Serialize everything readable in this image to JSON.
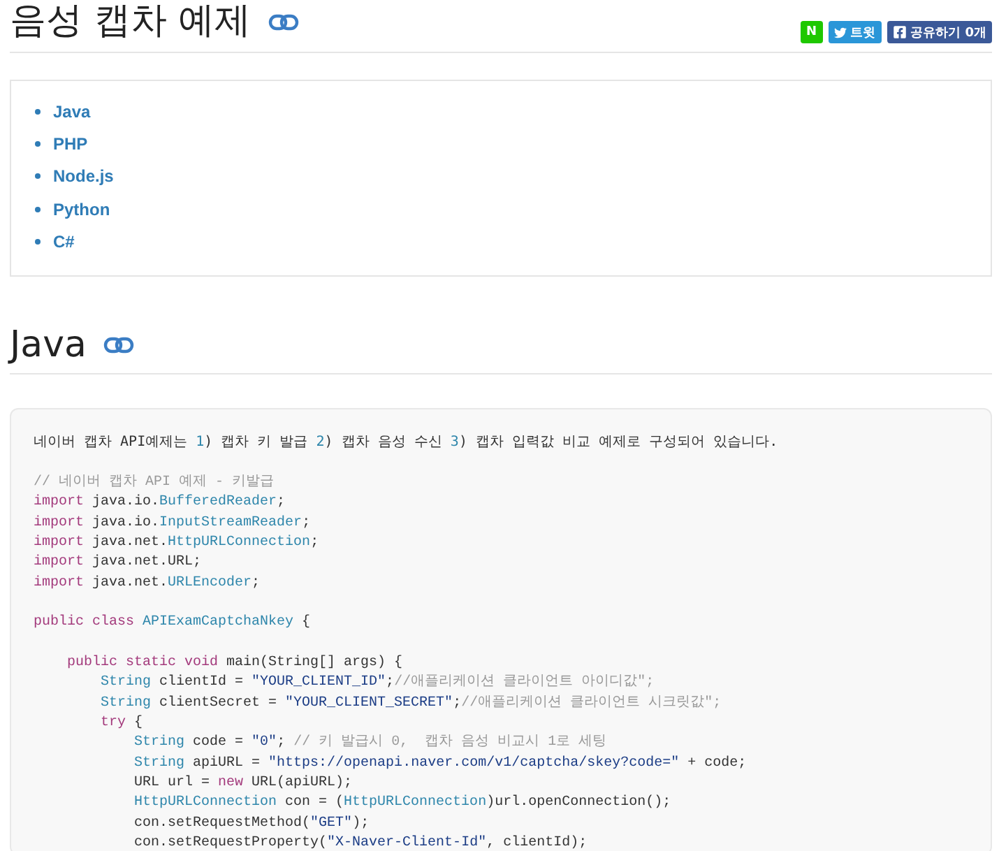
{
  "title": {
    "text": "음성 캡차 예제"
  },
  "share_buttons": [
    {
      "kind": "naver",
      "label": "N"
    },
    {
      "kind": "twitter",
      "label": "트윗"
    },
    {
      "kind": "facebook",
      "label": "공유하기 0개"
    }
  ],
  "toc": [
    "Java",
    "PHP",
    "Node.js",
    "Python",
    "C#"
  ],
  "section": {
    "title": "Java"
  },
  "intro": [
    {
      "kind": "plain",
      "text": "네이버 캡차 API예제는 "
    },
    {
      "kind": "number",
      "text": "1"
    },
    {
      "kind": "plain",
      "text": ") 캡차 키 발급 "
    },
    {
      "kind": "number",
      "text": "2"
    },
    {
      "kind": "plain",
      "text": ") 캡차 음성 수신 "
    },
    {
      "kind": "number",
      "text": "3"
    },
    {
      "kind": "plain",
      "text": ") 캡차 입력값 비교 예제로 구성되어 있습니다."
    }
  ],
  "code_blocks": [
    [
      [
        {
          "kind": "comment",
          "text": "// 네이버 캡차 API 예제 - 키발급"
        }
      ],
      [
        {
          "kind": "keyword",
          "text": "import"
        },
        {
          "kind": "plain",
          "text": " java.io."
        },
        {
          "kind": "type",
          "text": "BufferedReader"
        },
        {
          "kind": "plain",
          "text": ";"
        }
      ],
      [
        {
          "kind": "keyword",
          "text": "import"
        },
        {
          "kind": "plain",
          "text": " java.io."
        },
        {
          "kind": "type",
          "text": "InputStreamReader"
        },
        {
          "kind": "plain",
          "text": ";"
        }
      ],
      [
        {
          "kind": "keyword",
          "text": "import"
        },
        {
          "kind": "plain",
          "text": " java.net."
        },
        {
          "kind": "type",
          "text": "HttpURLConnection"
        },
        {
          "kind": "plain",
          "text": ";"
        }
      ],
      [
        {
          "kind": "keyword",
          "text": "import"
        },
        {
          "kind": "plain",
          "text": " java.net.URL;"
        }
      ],
      [
        {
          "kind": "keyword",
          "text": "import"
        },
        {
          "kind": "plain",
          "text": " java.net."
        },
        {
          "kind": "type",
          "text": "URLEncoder"
        },
        {
          "kind": "plain",
          "text": ";"
        }
      ]
    ],
    [
      [
        {
          "kind": "keyword",
          "text": "public class"
        },
        {
          "kind": "type",
          "text": " APIExamCaptchaNkey"
        },
        {
          "kind": "plain",
          "text": " {"
        }
      ]
    ],
    [
      [
        {
          "kind": "keyword",
          "text": "    public static void"
        },
        {
          "kind": "plain",
          "text": " main(String[] args) {"
        }
      ],
      [
        {
          "kind": "type",
          "text": "        String"
        },
        {
          "kind": "plain",
          "text": " clientId = "
        },
        {
          "kind": "string",
          "text": "\"YOUR_CLIENT_ID\""
        },
        {
          "kind": "plain",
          "text": ";"
        },
        {
          "kind": "comment",
          "text": "//애플리케이션 클라이언트 아이디값\";"
        }
      ],
      [
        {
          "kind": "type",
          "text": "        String"
        },
        {
          "kind": "plain",
          "text": " clientSecret = "
        },
        {
          "kind": "string",
          "text": "\"YOUR_CLIENT_SECRET\""
        },
        {
          "kind": "plain",
          "text": ";"
        },
        {
          "kind": "comment",
          "text": "//애플리케이션 클라이언트 시크릿값\";"
        }
      ],
      [
        {
          "kind": "keyword",
          "text": "        try"
        },
        {
          "kind": "plain",
          "text": " {"
        }
      ],
      [
        {
          "kind": "type",
          "text": "            String"
        },
        {
          "kind": "plain",
          "text": " code = "
        },
        {
          "kind": "string",
          "text": "\"0\""
        },
        {
          "kind": "plain",
          "text": "; "
        },
        {
          "kind": "comment",
          "text": "// 키 발급시 0,  캡차 음성 비교시 1로 세팅"
        }
      ],
      [
        {
          "kind": "type",
          "text": "            String"
        },
        {
          "kind": "plain",
          "text": " apiURL = "
        },
        {
          "kind": "string",
          "text": "\"https://openapi.naver.com/v1/captcha/skey?code=\""
        },
        {
          "kind": "plain",
          "text": " + code;"
        }
      ],
      [
        {
          "kind": "plain",
          "text": "            URL url = "
        },
        {
          "kind": "keyword",
          "text": "new"
        },
        {
          "kind": "plain",
          "text": " URL(apiURL);"
        }
      ],
      [
        {
          "kind": "type",
          "text": "            HttpURLConnection"
        },
        {
          "kind": "plain",
          "text": " con = ("
        },
        {
          "kind": "type",
          "text": "HttpURLConnection"
        },
        {
          "kind": "plain",
          "text": ")url.openConnection();"
        }
      ],
      [
        {
          "kind": "plain",
          "text": "            con.setRequestMethod("
        },
        {
          "kind": "string",
          "text": "\"GET\""
        },
        {
          "kind": "plain",
          "text": ");"
        }
      ],
      [
        {
          "kind": "plain",
          "text": "            con.setRequestProperty("
        },
        {
          "kind": "string",
          "text": "\"X-Naver-Client-Id\""
        },
        {
          "kind": "plain",
          "text": ", clientId);"
        }
      ]
    ]
  ]
}
